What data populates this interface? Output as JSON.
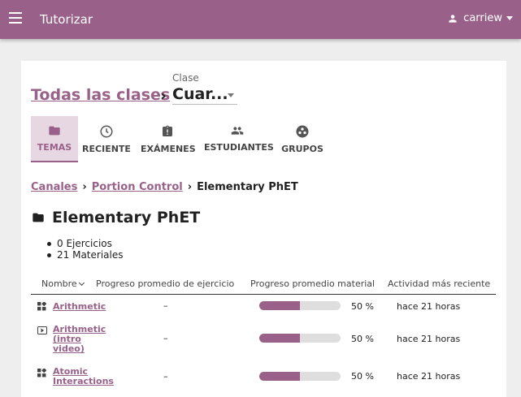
{
  "appbar": {
    "title": "Tutorizar",
    "username": "carriew",
    "color": "#996189"
  },
  "header": {
    "all_classes": "Todas las clases",
    "separator": "›",
    "class_label": "Clase",
    "class_value": "Cuar..."
  },
  "tabs": [
    {
      "label": "TEMAS",
      "icon": "folder-icon",
      "active": true
    },
    {
      "label": "RECIENTE",
      "icon": "clock-icon",
      "active": false
    },
    {
      "label": "EXÁMENES",
      "icon": "assignment-icon",
      "active": false
    },
    {
      "label": "ESTUDIANTES",
      "icon": "people-icon",
      "active": false
    },
    {
      "label": "GRUPOS",
      "icon": "groups-icon",
      "active": false
    }
  ],
  "breadcrumbs": {
    "items": [
      "Canales",
      "Portion Control"
    ],
    "current": "Elementary PhET",
    "separator": "›"
  },
  "topic": {
    "title": "Elementary PhET",
    "stats": [
      "0 Ejercicios",
      "21 Materiales"
    ]
  },
  "table": {
    "headers": [
      "Nombre",
      "Progreso promedio de ejercicio",
      "Progreso promedio material",
      "Actividad más reciente"
    ],
    "rows": [
      {
        "icon": "app-icon",
        "name": "Arithmetic",
        "exercise": "–",
        "progress": 50,
        "progress_label": "50 %",
        "activity": "hace 21 horas"
      },
      {
        "icon": "video-icon",
        "name": "Arithmetic (intro video)",
        "exercise": "–",
        "progress": 50,
        "progress_label": "50 %",
        "activity": "hace 21 horas"
      },
      {
        "icon": "app-icon",
        "name": "Atomic Interactions",
        "exercise": "–",
        "progress": 50,
        "progress_label": "50 %",
        "activity": "hace 21 horas"
      }
    ]
  }
}
